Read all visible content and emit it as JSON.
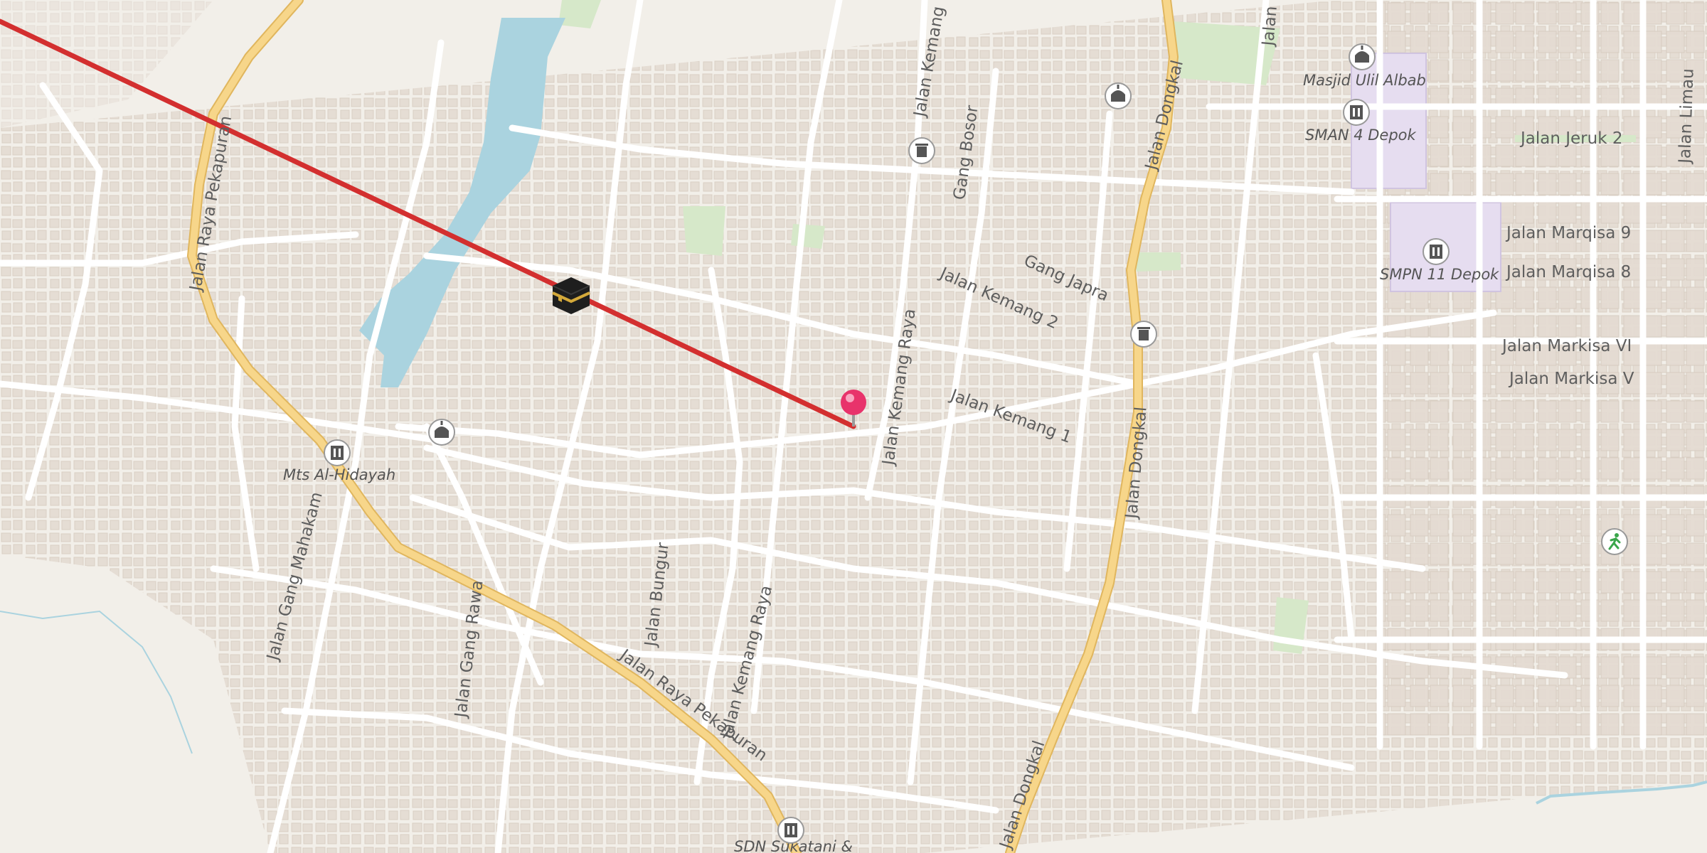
{
  "colors": {
    "background": "#f2efe9",
    "building": "#e4dbd2",
    "building_stroke": "#d6cbc0",
    "road": "#ffffff",
    "primary_road": "#f7d68a",
    "primary_road_casing": "#e0b65e",
    "water": "#aad3df",
    "park": "#d6e8c9",
    "school": "#e8e0f0",
    "route_line": "#d32f2f",
    "pin": "#e8336b"
  },
  "road_labels": {
    "jalan_raya_pekapuran_1": "Jalan Raya Pekapuran",
    "jalan_raya_pekapuran_2": "Jalan Raya Pekapuran",
    "jalan_gang_mahakam": "Jalan Gang Mahakam",
    "jalan_gang_rawa": "Jalan Gang Rawa",
    "jalan_bungur": "Jalan Bungur",
    "jalan_kemang_raya_1": "Jalan Kemang Raya",
    "jalan_kemang_raya_2": "Jalan Kemang Raya",
    "jalan_kemang_top": "Jalan Kemang",
    "gang_bosor": "Gang Bosor",
    "gang_japra": "Gang Japra",
    "jalan_kemang_2": "Jalan Kemang 2",
    "jalan_kemang_1": "Jalan Kemang 1",
    "jalan_dongkal_1": "Jalan Dongkal",
    "jalan_dongkal_2": "Jalan Dongkal",
    "jalan_dongkal_3": "Jalan Dongkal",
    "jalan_top": "Jalan",
    "jalan_jeruk_2": "Jalan Jeruk 2",
    "jalan_limau": "Jalan Limau",
    "jalan_marqisa_9": "Jalan Marqisa 9",
    "jalan_marqisa_8": "Jalan Marqisa 8",
    "jalan_markisa_vi": "Jalan Markisa VI",
    "jalan_markisa_v": "Jalan Markisa V"
  },
  "poi_labels": {
    "masjid_ulil_albab": "Masjid Ulil Albab",
    "sman_4_depok": "SMAN 4 Depok",
    "smpn_11_depok": "SMPN 11 Depok",
    "mts_al_hidayah": "Mts Al-Hidayah",
    "sdn_sukatani": "SDN Sukatani &"
  },
  "icons": {
    "kaaba": "kaaba-icon",
    "location_pin": "location-pin-icon",
    "mosque": "mosque-icon",
    "school": "school-icon",
    "waste": "waste-basket-icon",
    "sport": "running-person-icon"
  }
}
